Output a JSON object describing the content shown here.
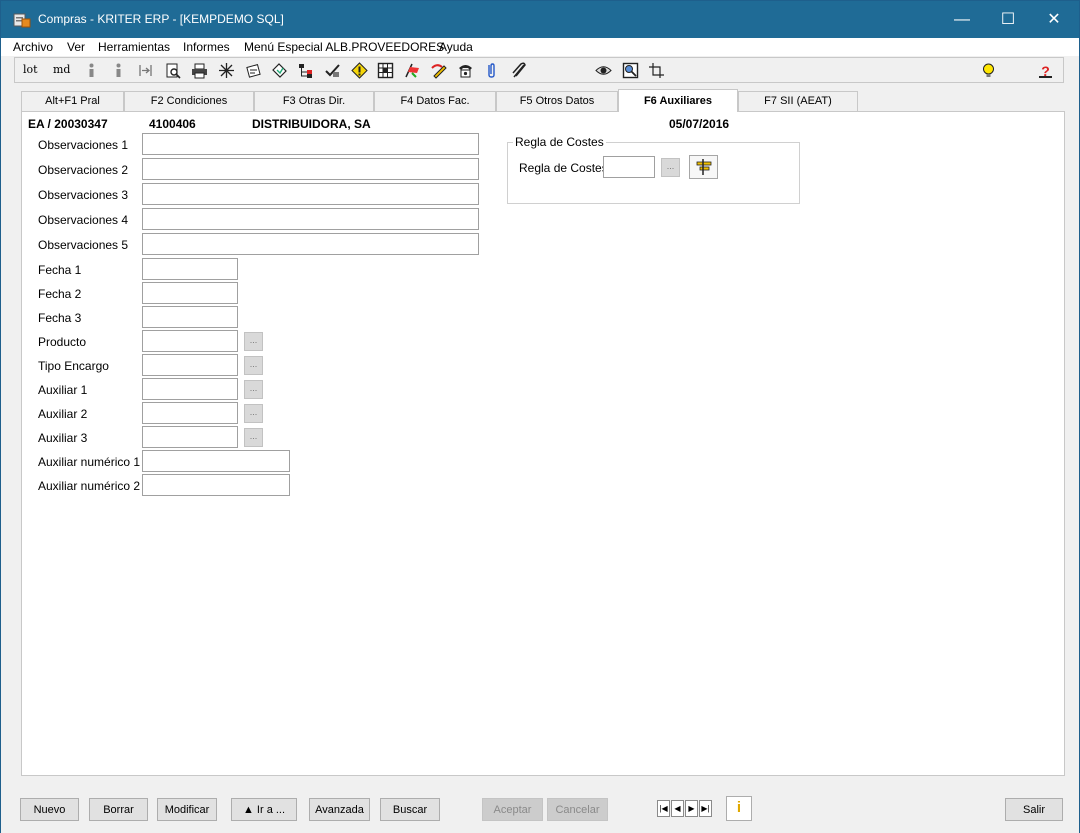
{
  "window": {
    "title": "Compras - KRITER ERP - [KEMPDEMO SQL]",
    "minimize_glyph": "—",
    "maximize_glyph": "☐",
    "close_glyph": "✕"
  },
  "menu": [
    "Archivo",
    "Ver",
    "Herramientas",
    "Informes",
    "Menú Especial ALB.PROVEEDORES",
    "Ayuda"
  ],
  "toolbar": {
    "text_buttons": [
      "lot",
      "md"
    ],
    "icons": [
      "info-icon",
      "info-icon",
      "insert-icon",
      "print-preview-icon",
      "print-icon",
      "asterisk-icon",
      "attach-doc-icon",
      "email-icon",
      "tree-icon",
      "check-mark-icon",
      "warning-icon",
      "grid-icon",
      "flag-icon",
      "pencil-icon",
      "phone-icon",
      "paperclip-icon",
      "clip-icon",
      "eye-icon",
      "search-icon",
      "crop-icon",
      "lightbulb-icon",
      "help-icon"
    ]
  },
  "tabs": [
    {
      "label": "Alt+F1 Pral",
      "active": false
    },
    {
      "label": "F2 Condiciones",
      "active": false
    },
    {
      "label": "F3 Otras Dir.",
      "active": false
    },
    {
      "label": "F4 Datos Fac.",
      "active": false
    },
    {
      "label": "F5 Otros Datos",
      "active": false
    },
    {
      "label": "F6 Auxiliares",
      "active": true
    },
    {
      "label": "F7 SII (AEAT)",
      "active": false
    }
  ],
  "header": {
    "document": "EA / 20030347",
    "code": "4100406",
    "name": "DISTRIBUIDORA, SA",
    "date": "05/07/2016"
  },
  "fields": {
    "obs1": {
      "label": "Observaciones 1",
      "value": ""
    },
    "obs2": {
      "label": "Observaciones 2",
      "value": ""
    },
    "obs3": {
      "label": "Observaciones 3",
      "value": ""
    },
    "obs4": {
      "label": "Observaciones 4",
      "value": ""
    },
    "obs5": {
      "label": "Observaciones 5",
      "value": ""
    },
    "fecha1": {
      "label": "Fecha 1",
      "value": ""
    },
    "fecha2": {
      "label": "Fecha 2",
      "value": ""
    },
    "fecha3": {
      "label": "Fecha 3",
      "value": ""
    },
    "producto": {
      "label": "Producto",
      "value": ""
    },
    "tipo_encargo": {
      "label": "Tipo Encargo",
      "value": ""
    },
    "aux1": {
      "label": "Auxiliar 1",
      "value": ""
    },
    "aux2": {
      "label": "Auxiliar 2",
      "value": ""
    },
    "aux3": {
      "label": "Auxiliar 3",
      "value": ""
    },
    "auxnum1": {
      "label": "Auxiliar numérico 1",
      "value": ""
    },
    "auxnum2": {
      "label": "Auxiliar numérico 2",
      "value": ""
    }
  },
  "ellipsis": "...",
  "regla": {
    "group_title": "Regla de Costes",
    "label": "Regla de Costes",
    "value": ""
  },
  "buttons": {
    "nuevo": "Nuevo",
    "borrar": "Borrar",
    "modificar": "Modificar",
    "ir_a": "▲ Ir a ...",
    "avanzada": "Avanzada",
    "buscar": "Buscar",
    "aceptar": "Aceptar",
    "cancelar": "Cancelar",
    "salir": "Salir"
  },
  "nav": {
    "first": "|◀",
    "prev": "◀",
    "next": "▶",
    "last": "▶|",
    "info_glyph": "i"
  },
  "colors": {
    "titlebar": "#1f6b96",
    "disabled_button": "#cccccc"
  }
}
